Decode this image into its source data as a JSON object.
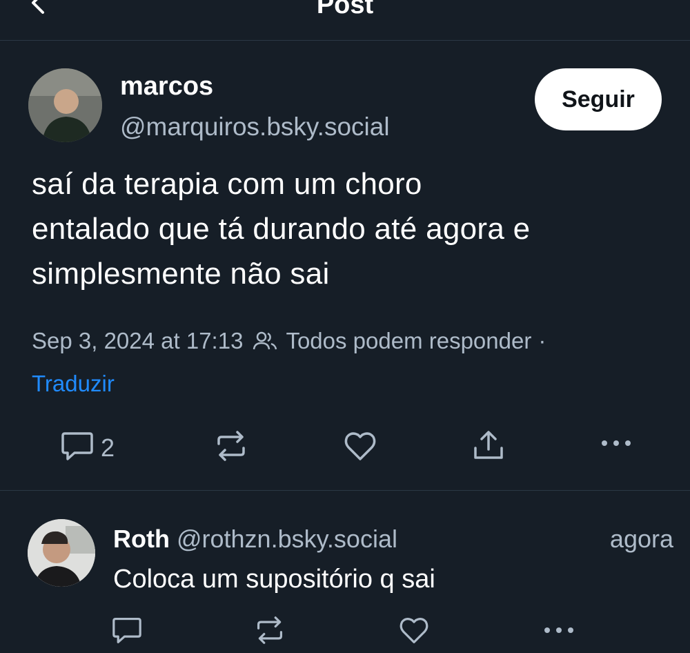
{
  "header": {
    "title": "Post"
  },
  "post": {
    "author_name": "marcos",
    "author_handle": "@marquiros.bsky.social",
    "follow_label": "Seguir",
    "text_lines": [
      "saí da terapia com um choro",
      "entalado que tá durando até agora e",
      "simplesmente não sai"
    ],
    "timestamp": "Sep 3, 2024 at 17:13",
    "reply_setting": "Todos podem responder",
    "separator": "·",
    "translate_label": "Traduzir",
    "reply_count": "2"
  },
  "reply": {
    "author_name": "Roth",
    "author_handle": "@rothzn.bsky.social",
    "time": "agora",
    "text": "Coloca um supositório q sai"
  },
  "colors": {
    "background": "#161e27",
    "muted": "#aebbc9",
    "link": "#208bfe",
    "divider": "#2b3845"
  }
}
